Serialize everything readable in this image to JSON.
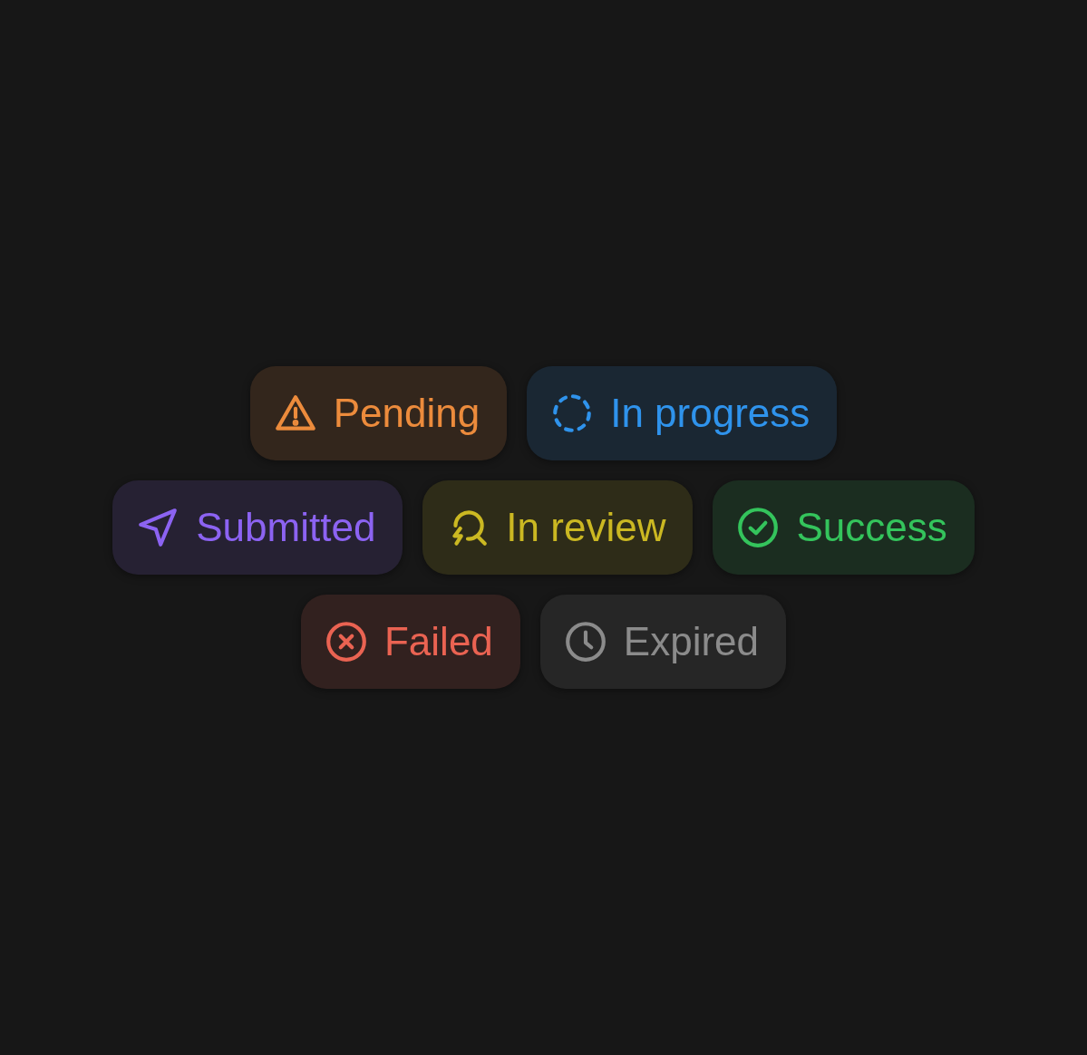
{
  "status_rows": [
    [
      {
        "kind": "warning",
        "label": "Pending",
        "color": "#ec8b3c"
      },
      {
        "kind": "loading",
        "label": "In progress",
        "color": "#2f93ec"
      }
    ],
    [
      {
        "kind": "send",
        "label": "Submitted",
        "color": "#8c63f2"
      },
      {
        "kind": "review",
        "label": "In review",
        "color": "#cbb822"
      },
      {
        "kind": "check",
        "label": "Success",
        "color": "#34c45c"
      }
    ],
    [
      {
        "kind": "error",
        "label": "Failed",
        "color": "#ea6352"
      },
      {
        "kind": "clock",
        "label": "Expired",
        "color": "#8b8b8b"
      }
    ]
  ]
}
